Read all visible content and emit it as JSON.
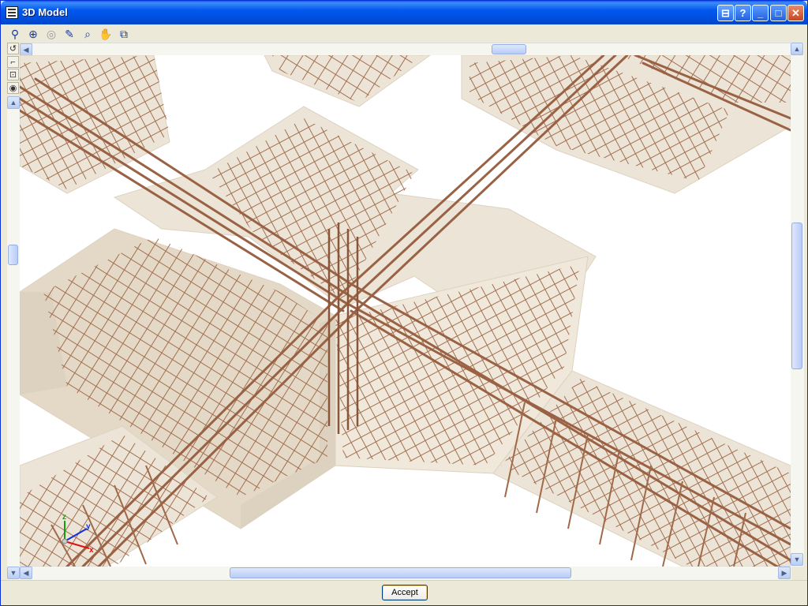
{
  "window": {
    "title": "3D Model",
    "icon": "table-grid-icon"
  },
  "titlebar_buttons": {
    "special_icon": "monitor-help-icon",
    "help": "?",
    "minimize": "_",
    "maximize": "□",
    "close": "✕"
  },
  "toolbar": {
    "tools": [
      {
        "name": "select-icon",
        "glyph": "⚲"
      },
      {
        "name": "zoom-extents-icon",
        "glyph": "⊕"
      },
      {
        "name": "zoom-previous-icon",
        "glyph": "◎"
      },
      {
        "name": "pencil-icon",
        "glyph": "✎"
      },
      {
        "name": "zoom-window-icon",
        "glyph": "⌕"
      },
      {
        "name": "pan-hand-icon",
        "glyph": "✋"
      },
      {
        "name": "copy-view-icon",
        "glyph": "⧉"
      }
    ]
  },
  "side_tools": [
    {
      "name": "rotate-icon",
      "glyph": "↺"
    },
    {
      "name": "section-icon",
      "glyph": "⌐"
    },
    {
      "name": "model-view-icon",
      "glyph": "⊡"
    },
    {
      "name": "visibility-icon",
      "glyph": "◉"
    }
  ],
  "axes": {
    "x": "x",
    "y": "y",
    "z": "z",
    "colors": {
      "x": "#e01010",
      "y": "#1030e0",
      "z": "#10a010"
    }
  },
  "colors": {
    "rebar": "#a0694a",
    "concrete": "#e8dfcf",
    "concrete_shadow": "#d5cbb8"
  },
  "footer": {
    "accept_label": "Accept"
  }
}
